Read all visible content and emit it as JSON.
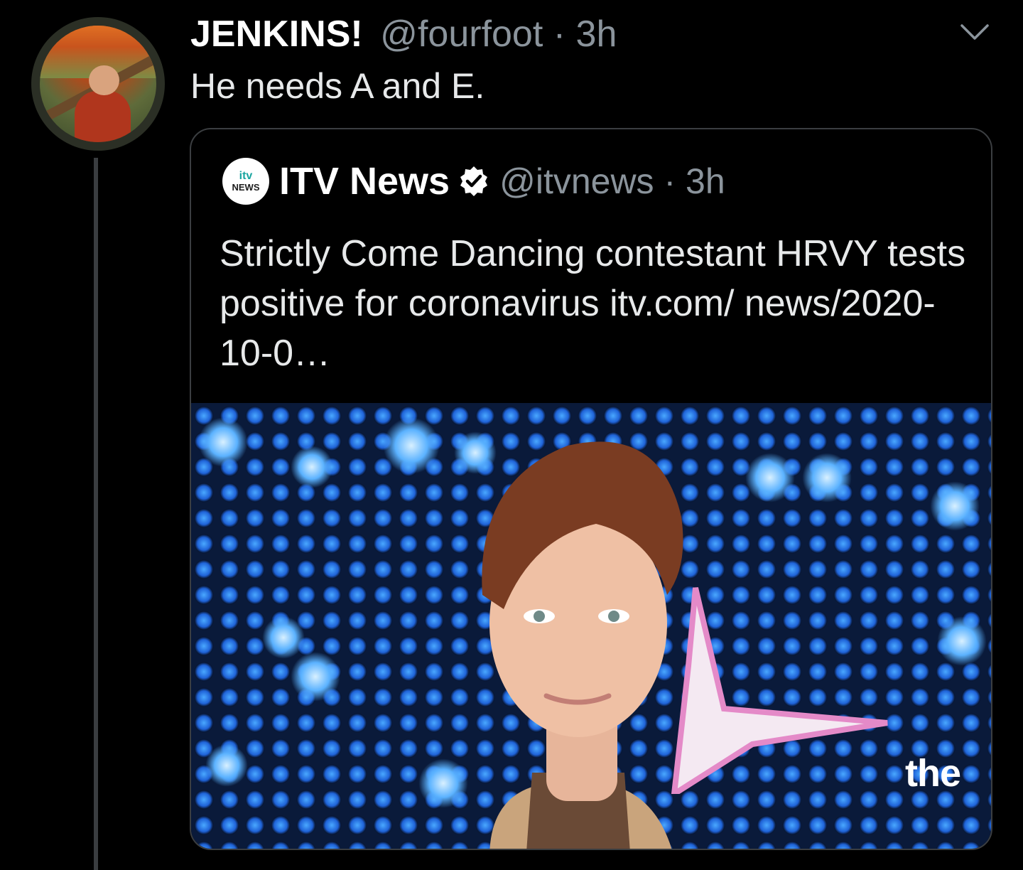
{
  "tweet": {
    "display_name": "JENKINS!",
    "handle": "@fourfoot",
    "separator": "·",
    "time": "3h",
    "text": "He needs A and E."
  },
  "quoted": {
    "logo_line1": "itv",
    "logo_line2": "NEWS",
    "display_name": "ITV News",
    "handle": "@itvnews",
    "separator": "·",
    "time": "3h",
    "text": "Strictly Come Dancing contestant HRVY tests positive for coronavirus itv.com/ news/2020-10-0…",
    "image_overlay_text": "the"
  },
  "icons": {
    "chevron": "chevron-down-icon",
    "verified": "verified-badge-icon"
  },
  "colors": {
    "background": "#000000",
    "text": "#e7e9ea",
    "muted": "#8b949c",
    "border": "#3b3e41",
    "thread_line": "#3a3d40"
  }
}
